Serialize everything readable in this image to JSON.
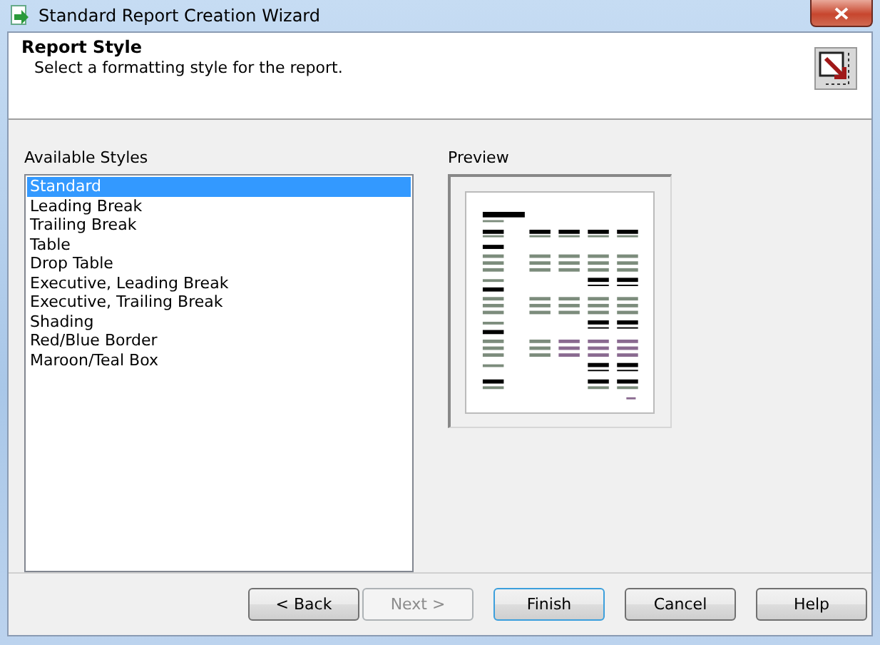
{
  "window": {
    "title": "Standard Report Creation Wizard"
  },
  "header": {
    "title": "Report Style",
    "subtitle": "Select a formatting style for the report."
  },
  "styles": {
    "label": "Available Styles",
    "items": [
      {
        "label": "Standard",
        "selected": true
      },
      {
        "label": "Leading Break",
        "selected": false
      },
      {
        "label": "Trailing Break",
        "selected": false
      },
      {
        "label": "Table",
        "selected": false
      },
      {
        "label": "Drop Table",
        "selected": false
      },
      {
        "label": "Executive, Leading Break",
        "selected": false
      },
      {
        "label": "Executive, Trailing Break",
        "selected": false
      },
      {
        "label": "Shading",
        "selected": false
      },
      {
        "label": "Red/Blue Border",
        "selected": false
      },
      {
        "label": "Maroon/Teal Box",
        "selected": false
      }
    ]
  },
  "preview": {
    "label": "Preview"
  },
  "buttons": [
    {
      "label": "< Back",
      "disabled": false,
      "default": false
    },
    {
      "label": "Next >",
      "disabled": true,
      "default": false
    },
    {
      "label": "Finish",
      "disabled": false,
      "default": true
    },
    {
      "label": "Cancel",
      "disabled": false,
      "default": false
    },
    {
      "label": "Help",
      "disabled": false,
      "default": false
    }
  ]
}
